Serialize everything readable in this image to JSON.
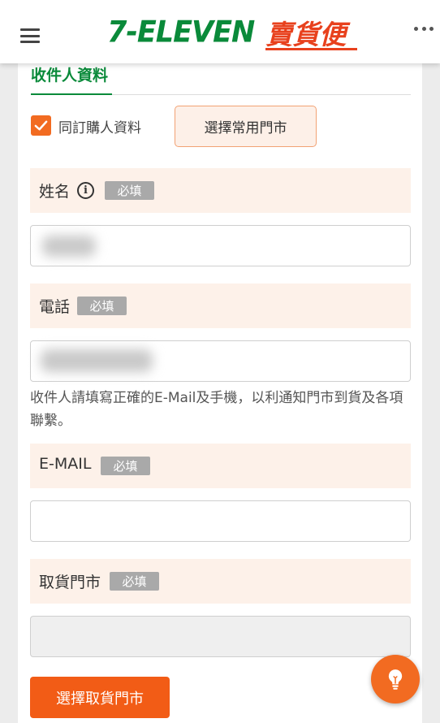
{
  "header": {
    "logo_main": "7-ELEVEN",
    "logo_sub": "賣貨便"
  },
  "section": {
    "title": "收件人資料"
  },
  "same_as_buyer": {
    "label": "同訂購人資料",
    "checked": true
  },
  "choose_common_store_label": "選擇常用門市",
  "fields": {
    "name": {
      "label": "姓名",
      "required": "必填"
    },
    "phone": {
      "label": "電話",
      "required": "必填"
    },
    "email": {
      "label": "E-MAIL",
      "required": "必填"
    },
    "pickup_store": {
      "label": "取貨門市",
      "required": "必填"
    }
  },
  "hint": "收件人請填寫正確的E-Mail及手機，以利通知門市到貨及各項聯繫。",
  "choose_pickup_store_label": "選擇取貨門市",
  "colors": {
    "brand_green": "#0a8a3a",
    "brand_orange": "#f26b21",
    "field_bg": "#fdf1e9"
  },
  "icons": {
    "menu": "hamburger-icon",
    "more": "more-dots-icon",
    "info": "info-icon",
    "check": "check-icon",
    "tip": "lightbulb-icon"
  }
}
